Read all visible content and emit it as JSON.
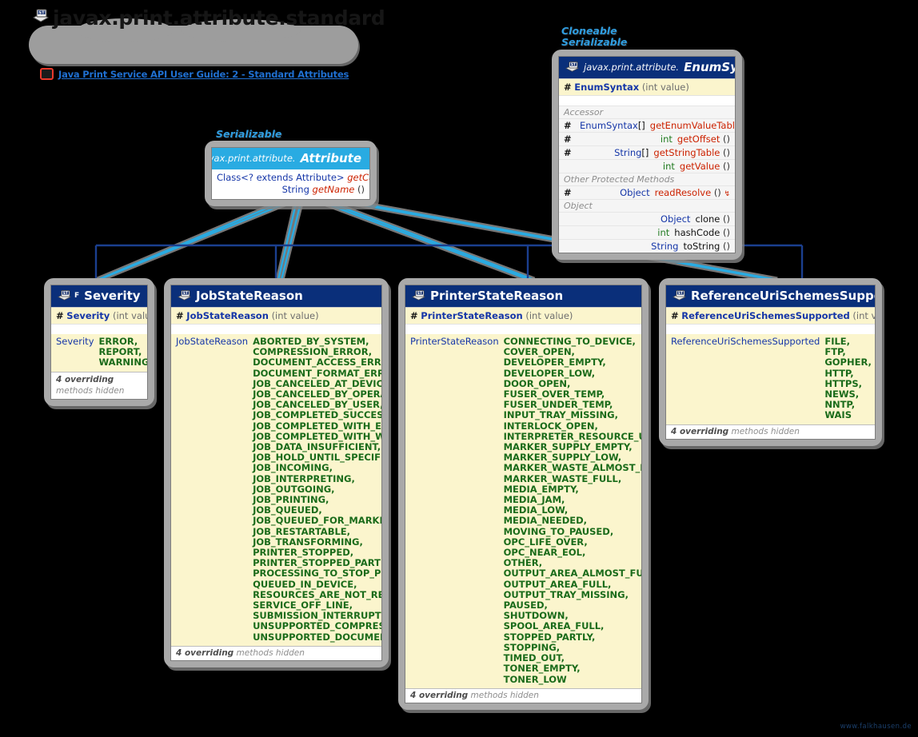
{
  "package": {
    "title": "javax.print.attribute.standard",
    "icon": "package-st-icon"
  },
  "doc_link": {
    "icon": "doc-link-icon",
    "text": "Java Print Service API User Guide: 2 - Standard Attributes"
  },
  "colors": {
    "class_header": "#0a2f7a",
    "interface_header": "#29abe2",
    "field_band": "#fbf5cd",
    "enum_value": "#1a6b1a",
    "type_blue": "#1536a8",
    "method_red": "#cc2200",
    "stereotype_blue": "#2f9de0",
    "link_blue": "#1f6fd0",
    "wire_light": "#29abe2",
    "wire_dark": "#1b3f8f",
    "background": "#000000"
  },
  "boxes": {
    "enum_syntax": {
      "stereotypes": [
        "Cloneable",
        "Serializable"
      ],
      "icon": "class-st-icon",
      "package_prefix": "javax.print.attribute.",
      "name": "EnumSyntax",
      "constructor": {
        "modifier": "#",
        "name": "EnumSyntax",
        "params": "(int value)"
      },
      "groups": [
        {
          "label": "Accessor",
          "rows": [
            {
              "modifier": "#",
              "type": "EnumSyntax",
              "dim": "[]",
              "name": "getEnumValueTable",
              "params": "()",
              "marker": ""
            },
            {
              "modifier": "#",
              "type": "int",
              "dim": "",
              "name": "getOffset",
              "params": "()",
              "marker": ""
            },
            {
              "modifier": "#",
              "type": "String",
              "dim": "[]",
              "name": "getStringTable",
              "params": "()",
              "marker": ""
            },
            {
              "modifier": "",
              "type": "int",
              "dim": "",
              "name": "getValue",
              "params": "()",
              "marker": ""
            }
          ]
        },
        {
          "label": "Other Protected Methods",
          "rows": [
            {
              "modifier": "#",
              "type": "Object",
              "dim": "",
              "name": "readResolve",
              "params": "()",
              "marker": "↯"
            }
          ]
        },
        {
          "label": "Object",
          "rows": [
            {
              "modifier": "",
              "type": "Object",
              "dim": "",
              "name": "clone",
              "params": "()",
              "marker": ""
            },
            {
              "modifier": "",
              "type": "int",
              "dim": "",
              "name": "hashCode",
              "params": "()",
              "marker": ""
            },
            {
              "modifier": "",
              "type": "String",
              "dim": "",
              "name": "toString",
              "params": "()",
              "marker": ""
            }
          ]
        }
      ]
    },
    "attribute": {
      "stereotypes": [
        "Serializable"
      ],
      "icon": "interface-icon",
      "package_prefix": "javax.print.attribute.",
      "name": "Attribute",
      "methods": [
        {
          "type": "Class<? extends Attribute>",
          "name": "getCategory",
          "params": "()"
        },
        {
          "type": "String",
          "name": "getName",
          "params": "()"
        }
      ]
    },
    "severity": {
      "icon": "class-st-icon",
      "final_marker": "F",
      "name": "Severity",
      "constructor": {
        "modifier": "#",
        "name": "Severity",
        "params": "(int value)"
      },
      "field_type": "Severity",
      "values": [
        "ERROR,",
        "REPORT,",
        "WARNING"
      ],
      "footer": {
        "count": "4 overriding",
        "text": "methods hidden"
      }
    },
    "job_state_reason": {
      "icon": "class-st-icon",
      "name": "JobStateReason",
      "constructor": {
        "modifier": "#",
        "name": "JobStateReason",
        "params": "(int value)"
      },
      "field_type": "JobStateReason",
      "values": [
        "ABORTED_BY_SYSTEM,",
        "COMPRESSION_ERROR,",
        "DOCUMENT_ACCESS_ERROR,",
        "DOCUMENT_FORMAT_ERROR,",
        "JOB_CANCELED_AT_DEVICE,",
        "JOB_CANCELED_BY_OPERATOR,",
        "JOB_CANCELED_BY_USER,",
        "JOB_COMPLETED_SUCCESSFULLY,",
        "JOB_COMPLETED_WITH_ERRORS,",
        "JOB_COMPLETED_WITH_WARNINGS,",
        "JOB_DATA_INSUFFICIENT,",
        "JOB_HOLD_UNTIL_SPECIFIED,",
        "JOB_INCOMING,",
        "JOB_INTERPRETING,",
        "JOB_OUTGOING,",
        "JOB_PRINTING,",
        "JOB_QUEUED,",
        "JOB_QUEUED_FOR_MARKER,",
        "JOB_RESTARTABLE,",
        "JOB_TRANSFORMING,",
        "PRINTER_STOPPED,",
        "PRINTER_STOPPED_PARTLY,",
        "PROCESSING_TO_STOP_POINT,",
        "QUEUED_IN_DEVICE,",
        "RESOURCES_ARE_NOT_READY,",
        "SERVICE_OFF_LINE,",
        "SUBMISSION_INTERRUPTED,",
        "UNSUPPORTED_COMPRESSION,",
        "UNSUPPORTED_DOCUMENT_FORMAT"
      ],
      "footer": {
        "count": "4 overriding",
        "text": "methods hidden"
      }
    },
    "printer_state_reason": {
      "icon": "class-st-icon",
      "name": "PrinterStateReason",
      "constructor": {
        "modifier": "#",
        "name": "PrinterStateReason",
        "params": "(int value)"
      },
      "field_type": "PrinterStateReason",
      "values": [
        "CONNECTING_TO_DEVICE,",
        "COVER_OPEN,",
        "DEVELOPER_EMPTY,",
        "DEVELOPER_LOW,",
        "DOOR_OPEN,",
        "FUSER_OVER_TEMP,",
        "FUSER_UNDER_TEMP,",
        "INPUT_TRAY_MISSING,",
        "INTERLOCK_OPEN,",
        "INTERPRETER_RESOURCE_UNAVAILABLE,",
        "MARKER_SUPPLY_EMPTY,",
        "MARKER_SUPPLY_LOW,",
        "MARKER_WASTE_ALMOST_FULL,",
        "MARKER_WASTE_FULL,",
        "MEDIA_EMPTY,",
        "MEDIA_JAM,",
        "MEDIA_LOW,",
        "MEDIA_NEEDED,",
        "MOVING_TO_PAUSED,",
        "OPC_LIFE_OVER,",
        "OPC_NEAR_EOL,",
        "OTHER,",
        "OUTPUT_AREA_ALMOST_FULL,",
        "OUTPUT_AREA_FULL,",
        "OUTPUT_TRAY_MISSING,",
        "PAUSED,",
        "SHUTDOWN,",
        "SPOOL_AREA_FULL,",
        "STOPPED_PARTLY,",
        "STOPPING,",
        "TIMED_OUT,",
        "TONER_EMPTY,",
        "TONER_LOW"
      ],
      "footer": {
        "count": "4 overriding",
        "text": "methods hidden"
      }
    },
    "reference_uri_schemes_supported": {
      "icon": "class-st-icon",
      "name": "ReferenceUriSchemesSupported",
      "constructor": {
        "modifier": "#",
        "name": "ReferenceUriSchemesSupported",
        "params": "(int value)"
      },
      "field_type": "ReferenceUriSchemesSupported",
      "values": [
        "FILE,",
        "FTP,",
        "GOPHER,",
        "HTTP,",
        "HTTPS,",
        "NEWS,",
        "NNTP,",
        "WAIS"
      ],
      "footer": {
        "count": "4 overriding",
        "text": "methods hidden"
      }
    }
  },
  "watermark": "www.falkhausen.de"
}
